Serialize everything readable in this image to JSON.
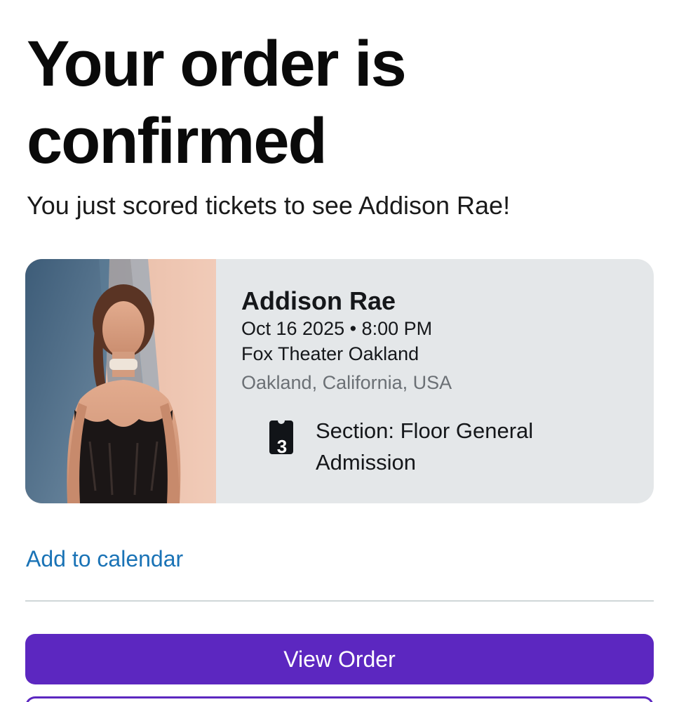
{
  "header": {
    "title": "Your order is confirmed",
    "subtitle": "You just scored tickets to see Addison Rae!"
  },
  "event_card": {
    "artist": "Addison Rae",
    "datetime": "Oct 16 2025 • 8:00 PM",
    "venue": "Fox Theater Oakland",
    "location": "Oakland, California, USA",
    "ticket_icon": "ticket-icon",
    "ticket_count": "3",
    "section": "Section: Floor General Admission"
  },
  "actions": {
    "add_to_calendar": "Add to calendar",
    "view_order": "View Order"
  },
  "colors": {
    "accent": "#5c27c0",
    "link": "#1a73b6",
    "card_background": "#e4e7e9",
    "secondary_text": "#6b7075"
  }
}
